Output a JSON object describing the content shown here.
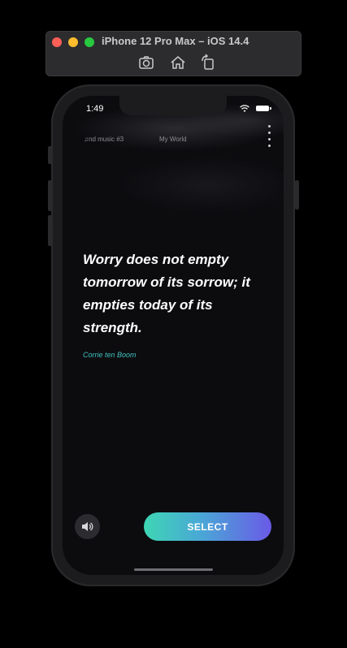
{
  "simulator": {
    "title": "iPhone 12 Pro Max – iOS 14.4",
    "toolbar": {
      "screenshot_icon": "camera-icon",
      "home_icon": "home-icon",
      "rotate_icon": "rotate-icon"
    },
    "window_controls": {
      "close_color": "#fe5f57",
      "minimize_color": "#febc2e",
      "zoom_color": "#28c840"
    }
  },
  "status_bar": {
    "time": "1:49"
  },
  "top_nav": {
    "music_label": "♫nd music #3",
    "world_label": "My World",
    "menu_icon": "vertical-dots-icon"
  },
  "quote": {
    "text": "Worry does not empty tomorrow of its sorrow; it empties today of its strength.",
    "author": "Corrie ten Boom"
  },
  "controls": {
    "sound_icon": "speaker-icon",
    "select_label": "SELECT"
  },
  "colors": {
    "author_accent": "#3fc3c0",
    "button_gradient_start": "#3ed6b4",
    "button_gradient_end": "#6a5ae6",
    "screen_background": "#0c0c0f"
  }
}
